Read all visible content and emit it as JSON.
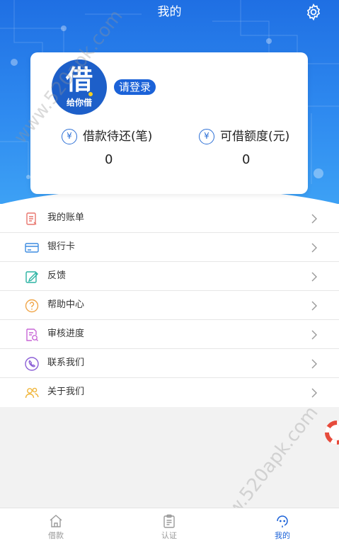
{
  "header": {
    "title": "我的",
    "settings_icon": "gear-icon"
  },
  "profile": {
    "logo_char": "借",
    "logo_sub": "给你借",
    "login_label": "请登录",
    "stats": [
      {
        "label": "借款待还(笔)",
        "value": "0",
        "icon": "yen-cycle-icon"
      },
      {
        "label": "可借额度(元)",
        "value": "0",
        "icon": "yen-circle-icon"
      }
    ],
    "yen_symbol": "¥"
  },
  "menu": [
    {
      "label": "我的账单",
      "icon": "bill-icon"
    },
    {
      "label": "银行卡",
      "icon": "bank-card-icon"
    },
    {
      "label": "反馈",
      "icon": "feedback-edit-icon"
    },
    {
      "label": "帮助中心",
      "icon": "help-question-icon"
    },
    {
      "label": "审核进度",
      "icon": "review-progress-icon"
    },
    {
      "label": "联系我们",
      "icon": "phone-icon"
    },
    {
      "label": "关于我们",
      "icon": "users-icon"
    }
  ],
  "watermark": "www.520apk.com",
  "tabbar": [
    {
      "label": "借款",
      "icon": "home-icon",
      "active": false
    },
    {
      "label": "认证",
      "icon": "clipboard-icon",
      "active": false
    },
    {
      "label": "我的",
      "icon": "user-face-icon",
      "active": true
    }
  ],
  "colors": {
    "primary": "#1b62d8",
    "header_top": "#1f6fe3",
    "header_bottom": "#3ea3f5"
  }
}
